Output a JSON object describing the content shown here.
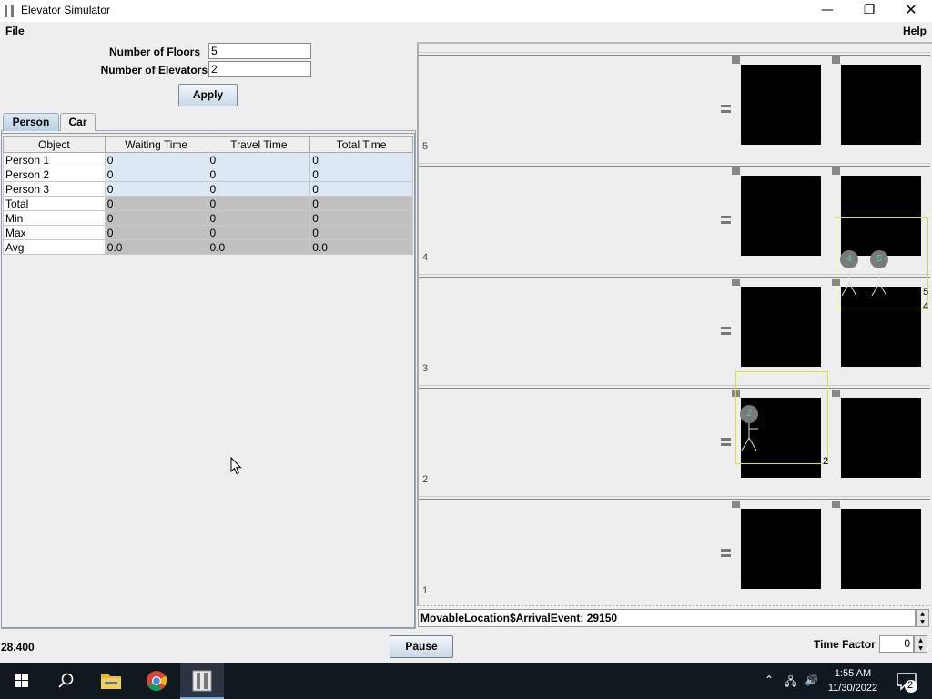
{
  "window": {
    "title": "Elevator Simulator",
    "min_glyph": "—",
    "max_glyph": "❐",
    "close_glyph": "✕"
  },
  "menu": {
    "file": "File",
    "help": "Help"
  },
  "form": {
    "floors_label": "Number of Floors",
    "floors_value": "5",
    "elevators_label": "Number of Elevators",
    "elevators_value": "2",
    "apply_label": "Apply"
  },
  "tabs": [
    {
      "label": "Person",
      "selected": true
    },
    {
      "label": "Car",
      "selected": false
    }
  ],
  "table": {
    "columns": [
      "Object",
      "Waiting Time",
      "Travel Time",
      "Total Time"
    ],
    "rows": [
      {
        "object": "Person 1",
        "waiting": "0",
        "travel": "0",
        "total": "0"
      },
      {
        "object": "Person 2",
        "waiting": "0",
        "travel": "0",
        "total": "0"
      },
      {
        "object": "Person 3",
        "waiting": "0",
        "travel": "0",
        "total": "0"
      },
      {
        "object": "Total",
        "waiting": "0",
        "travel": "0",
        "total": "0"
      },
      {
        "object": "Min",
        "waiting": "0",
        "travel": "0",
        "total": "0"
      },
      {
        "object": "Max",
        "waiting": "0",
        "travel": "0",
        "total": "0"
      },
      {
        "object": "Avg",
        "waiting": "0.0",
        "travel": "0.0",
        "total": "0.0"
      }
    ]
  },
  "status": {
    "clock": "28.400",
    "pause_label": "Pause",
    "time_factor_label": "Time Factor",
    "time_factor_value": "0",
    "event_text": "MovableLocation$ArrivalEvent: 29150"
  },
  "sim": {
    "floor_labels": [
      "5",
      "4",
      "3",
      "2",
      "1"
    ],
    "car1_floor_labels": [
      "5",
      "4"
    ],
    "car2_floor_label": "2",
    "person_ids": [
      "4",
      "5",
      "2"
    ]
  },
  "taskbar": {
    "time": "1:55 AM",
    "date": "11/30/2022",
    "notifications": "2"
  },
  "colors": {
    "person_row": "#dde8f5",
    "stat_row": "#c0c0c0",
    "car_frame": "#d8e040",
    "person_id_text": "#49d4a6"
  }
}
